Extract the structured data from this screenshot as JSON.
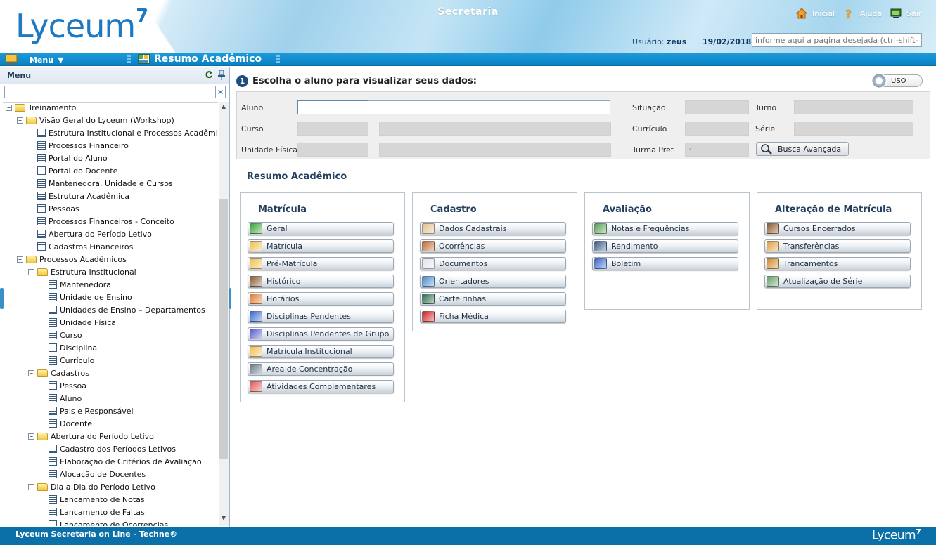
{
  "header": {
    "logo_text": "Lyceum",
    "logo_sup": "7",
    "app_title": "Secretaria",
    "links": {
      "home": "Inicial",
      "help": "Ajuda",
      "exit": "Sair"
    },
    "user_label": "Usuário:",
    "user_name": "zeus",
    "date": "19/02/2018",
    "page_search_placeholder": "informe aqui a página desejada (ctrl-shift-m)"
  },
  "menubar": {
    "menu_label": "Menu",
    "module_title": "Resumo Acadêmico"
  },
  "sidebar": {
    "title": "Menu",
    "tree": [
      {
        "label": "Treinamento",
        "type": "folder",
        "level": 0,
        "toggle": "−"
      },
      {
        "label": "Visão Geral do Lyceum (Workshop)",
        "type": "folder",
        "level": 1,
        "toggle": "−"
      },
      {
        "label": "Estrutura Institucional e Processos Acadêmicos",
        "type": "doc",
        "level": 2
      },
      {
        "label": "Processos Financeiro",
        "type": "doc",
        "level": 2
      },
      {
        "label": "Portal do Aluno",
        "type": "doc",
        "level": 2
      },
      {
        "label": "Portal do Docente",
        "type": "doc",
        "level": 2
      },
      {
        "label": "Mantenedora, Unidade e Cursos",
        "type": "doc",
        "level": 2
      },
      {
        "label": "Estrutura Acadêmica",
        "type": "doc",
        "level": 2
      },
      {
        "label": "Pessoas",
        "type": "doc",
        "level": 2
      },
      {
        "label": "Processos Financeiros - Conceito",
        "type": "doc",
        "level": 2
      },
      {
        "label": "Abertura do Período Letivo",
        "type": "doc",
        "level": 2
      },
      {
        "label": "Cadastros Financeiros",
        "type": "doc",
        "level": 2
      },
      {
        "label": "Processos Acadêmicos",
        "type": "folder",
        "level": 1,
        "toggle": "−"
      },
      {
        "label": "Estrutura Institucional",
        "type": "folder",
        "level": 2,
        "toggle": "−"
      },
      {
        "label": "Mantenedora",
        "type": "doc",
        "level": 3
      },
      {
        "label": "Unidade de Ensino",
        "type": "doc",
        "level": 3
      },
      {
        "label": "Unidades de Ensino – Departamentos",
        "type": "doc",
        "level": 3
      },
      {
        "label": "Unidade Física",
        "type": "doc",
        "level": 3
      },
      {
        "label": "Curso",
        "type": "doc",
        "level": 3
      },
      {
        "label": "Disciplina",
        "type": "doc",
        "level": 3
      },
      {
        "label": "Currículo",
        "type": "doc",
        "level": 3
      },
      {
        "label": "Cadastros",
        "type": "folder",
        "level": 2,
        "toggle": "−"
      },
      {
        "label": "Pessoa",
        "type": "doc",
        "level": 3
      },
      {
        "label": "Aluno",
        "type": "doc",
        "level": 3
      },
      {
        "label": "Pais e Responsável",
        "type": "doc",
        "level": 3
      },
      {
        "label": "Docente",
        "type": "doc",
        "level": 3
      },
      {
        "label": "Abertura do Período Letivo",
        "type": "folder",
        "level": 2,
        "toggle": "−"
      },
      {
        "label": "Cadastro dos Períodos Letivos",
        "type": "doc",
        "level": 3
      },
      {
        "label": "Elaboração de Critérios de Avaliação",
        "type": "doc",
        "level": 3
      },
      {
        "label": "Alocação de Docentes",
        "type": "doc",
        "level": 3
      },
      {
        "label": "Dia a Dia do Período Letivo",
        "type": "folder",
        "level": 2,
        "toggle": "−"
      },
      {
        "label": "Lancamento de Notas",
        "type": "doc",
        "level": 3
      },
      {
        "label": "Lancamento de Faltas",
        "type": "doc",
        "level": 3
      },
      {
        "label": "Lancamento de Ocorrencias",
        "type": "doc",
        "level": 3
      }
    ]
  },
  "main": {
    "choose_step": "1",
    "choose_title": "Escolha o aluno para visualizar seus dados:",
    "uso_label": "USO",
    "form": {
      "aluno": "Aluno",
      "curso": "Curso",
      "unidade": "Unidade Física",
      "situacao": "Situação",
      "curriculo": "Currículo",
      "turma": "Turma Pref.",
      "turma_value": "-",
      "turno": "Turno",
      "serie": "Série",
      "busca": "Busca Avançada"
    },
    "resumo_title": "Resumo Acadêmico",
    "cards": [
      {
        "title": "Matrícula",
        "items": [
          "Geral",
          "Matrícula",
          "Pré-Matrícula",
          "Histórico",
          "Horários",
          "Disciplinas Pendentes",
          "Disciplinas Pendentes de Grupo",
          "Matrícula Institucional",
          "Área de Concentração",
          "Atividades Complementares"
        ]
      },
      {
        "title": "Cadastro",
        "items": [
          "Dados Cadastrais",
          "Ocorrências",
          "Documentos",
          "Orientadores",
          "Carteirinhas",
          "Ficha Médica"
        ]
      },
      {
        "title": "Avaliação",
        "items": [
          "Notas e Frequências",
          "Rendimento",
          "Boletim"
        ]
      },
      {
        "title": "Alteração de Matrícula",
        "items": [
          "Cursos Encerrados",
          "Transferências",
          "Trancamentos",
          "Atualização de Série"
        ]
      }
    ]
  },
  "footer": {
    "text": "Lyceum Secretaria on Line - Techne®",
    "logo": "Lyceum",
    "logo_sup": "7"
  },
  "colors": {
    "accent": "#0b82c4",
    "title": "#233f5e",
    "footer": "#0b6fa8"
  }
}
